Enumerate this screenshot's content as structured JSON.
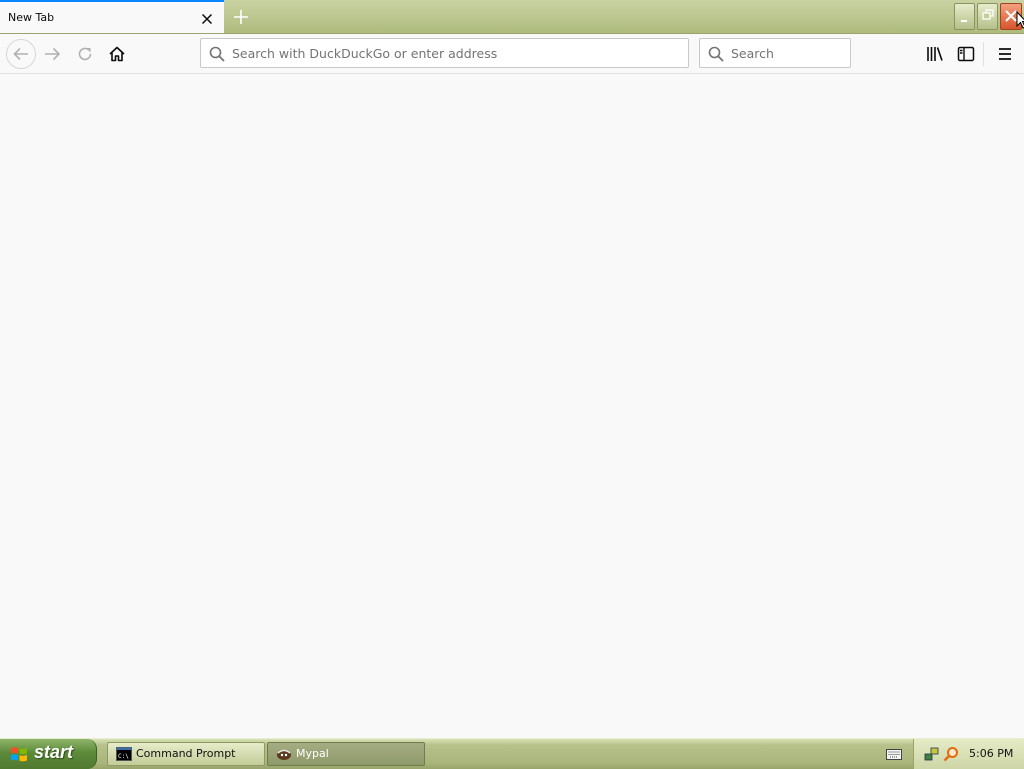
{
  "browser": {
    "tab": {
      "title": "New Tab"
    },
    "urlbar": {
      "placeholder": "Search with DuckDuckGo or enter address",
      "value": ""
    },
    "searchbar": {
      "placeholder": "Search",
      "value": ""
    }
  },
  "taskbar": {
    "start_label": "start",
    "tasks": [
      {
        "label": "Command Prompt",
        "active": false
      },
      {
        "label": "Mypal",
        "active": true
      }
    ],
    "clock": "5:06 PM"
  },
  "colors": {
    "accent": "#0a84ff",
    "tabstrip": "#aebb7c",
    "close_button": "#d6552e",
    "taskbar": "#a9b57b"
  }
}
